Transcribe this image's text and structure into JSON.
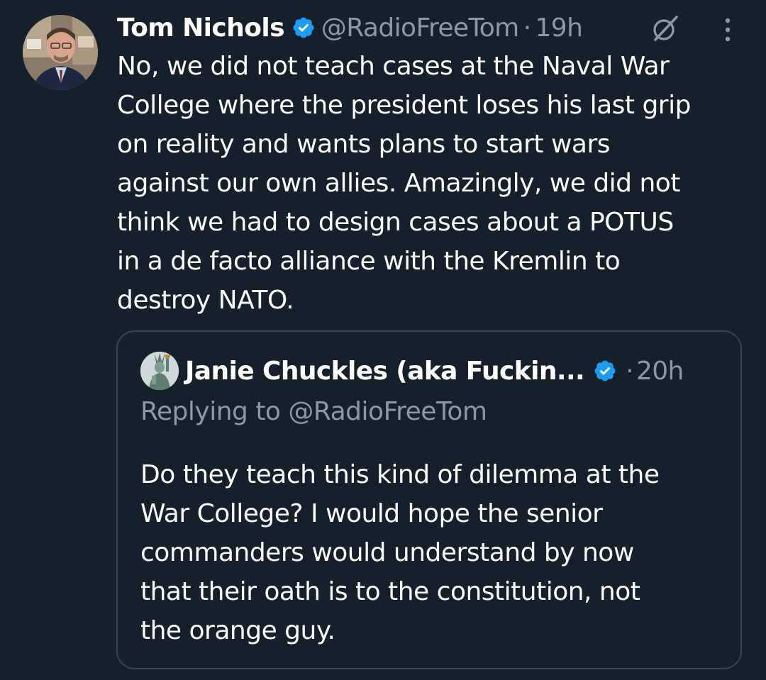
{
  "tweet": {
    "author_name": "Tom Nichols",
    "handle": "@RadioFreeTom",
    "separator": "·",
    "time": "19h",
    "text": "No, we did not teach cases at the Naval War\nCollege where the president loses his last grip\non reality and wants plans to start wars\nagainst our own allies. Amazingly, we did not\nthink we had to design cases about a POTUS\nin a de facto alliance with the Kremlin to\ndestroy NATO.",
    "icons": {
      "avatar": "profile-photo",
      "verified": "verified-badge-icon",
      "grok": "grok-icon",
      "more": "more-options-icon"
    }
  },
  "quoted_tweet": {
    "author_name": "Janie Chuckles (aka Fuckin...",
    "separator": "·",
    "time": "20h",
    "replying_to": "Replying to @RadioFreeTom",
    "text": "Do they teach this kind of dilemma at the\nWar College? I would hope the senior\ncommanders would understand by now\nthat their oath is to the constitution, not\nthe orange guy.",
    "icons": {
      "avatar": "statue-of-liberty-avatar",
      "verified": "verified-badge-icon"
    }
  },
  "colors": {
    "background": "#15202b",
    "text_primary": "#ffffff",
    "text_secondary": "#8b98a5",
    "verified_blue": "#1d9bf0",
    "card_border": "#38444d"
  }
}
